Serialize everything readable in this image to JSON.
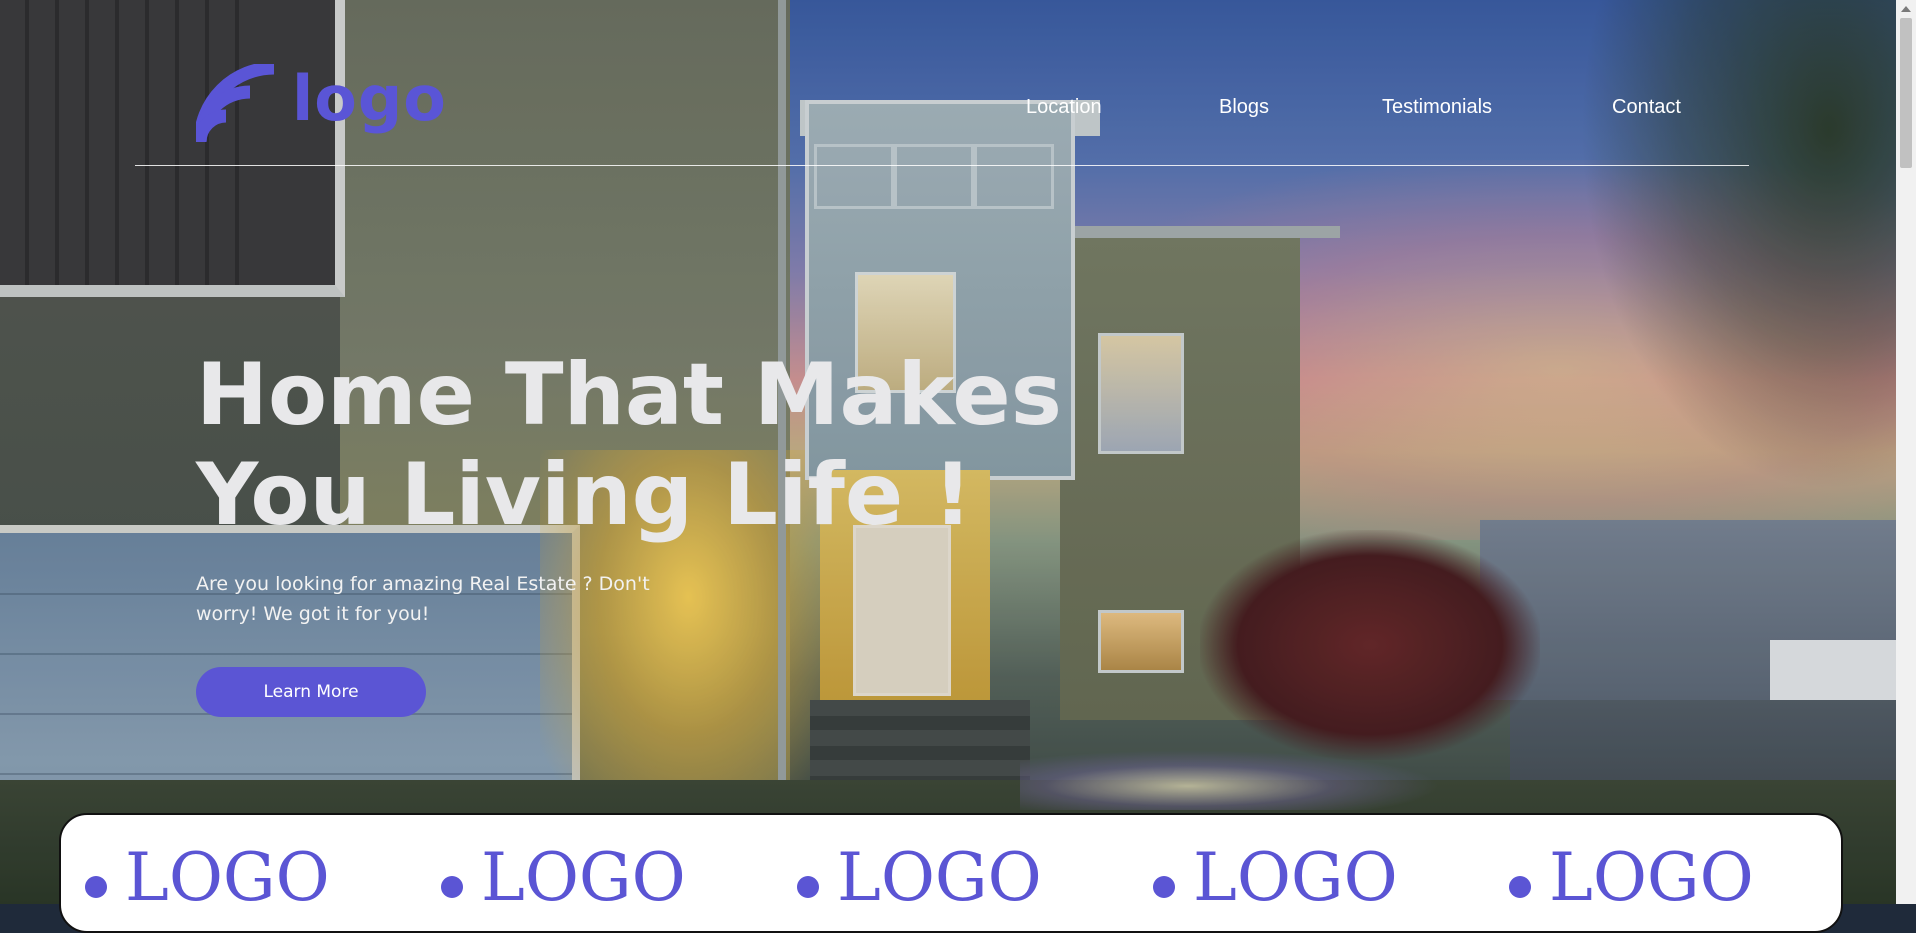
{
  "header": {
    "logo_text": "logo",
    "logo_icon": "wifi-signal-icon",
    "nav": [
      {
        "label": "Location"
      },
      {
        "label": "Blogs"
      },
      {
        "label": "Testimonials"
      },
      {
        "label": "Contact"
      }
    ]
  },
  "hero": {
    "headline_line1": "Home That Makes",
    "headline_line2": "You Living Life !",
    "subtext": "Are you looking for amazing Real Estate ? Don't worry! We got it for you!",
    "cta_label": "Learn More"
  },
  "partners": {
    "logos": [
      "LOGO",
      "LOGO",
      "LOGO",
      "LOGO",
      "LOGO"
    ]
  },
  "colors": {
    "accent": "#5b55d4",
    "text_light": "#ffffff",
    "headline": "#e8e8ea"
  }
}
